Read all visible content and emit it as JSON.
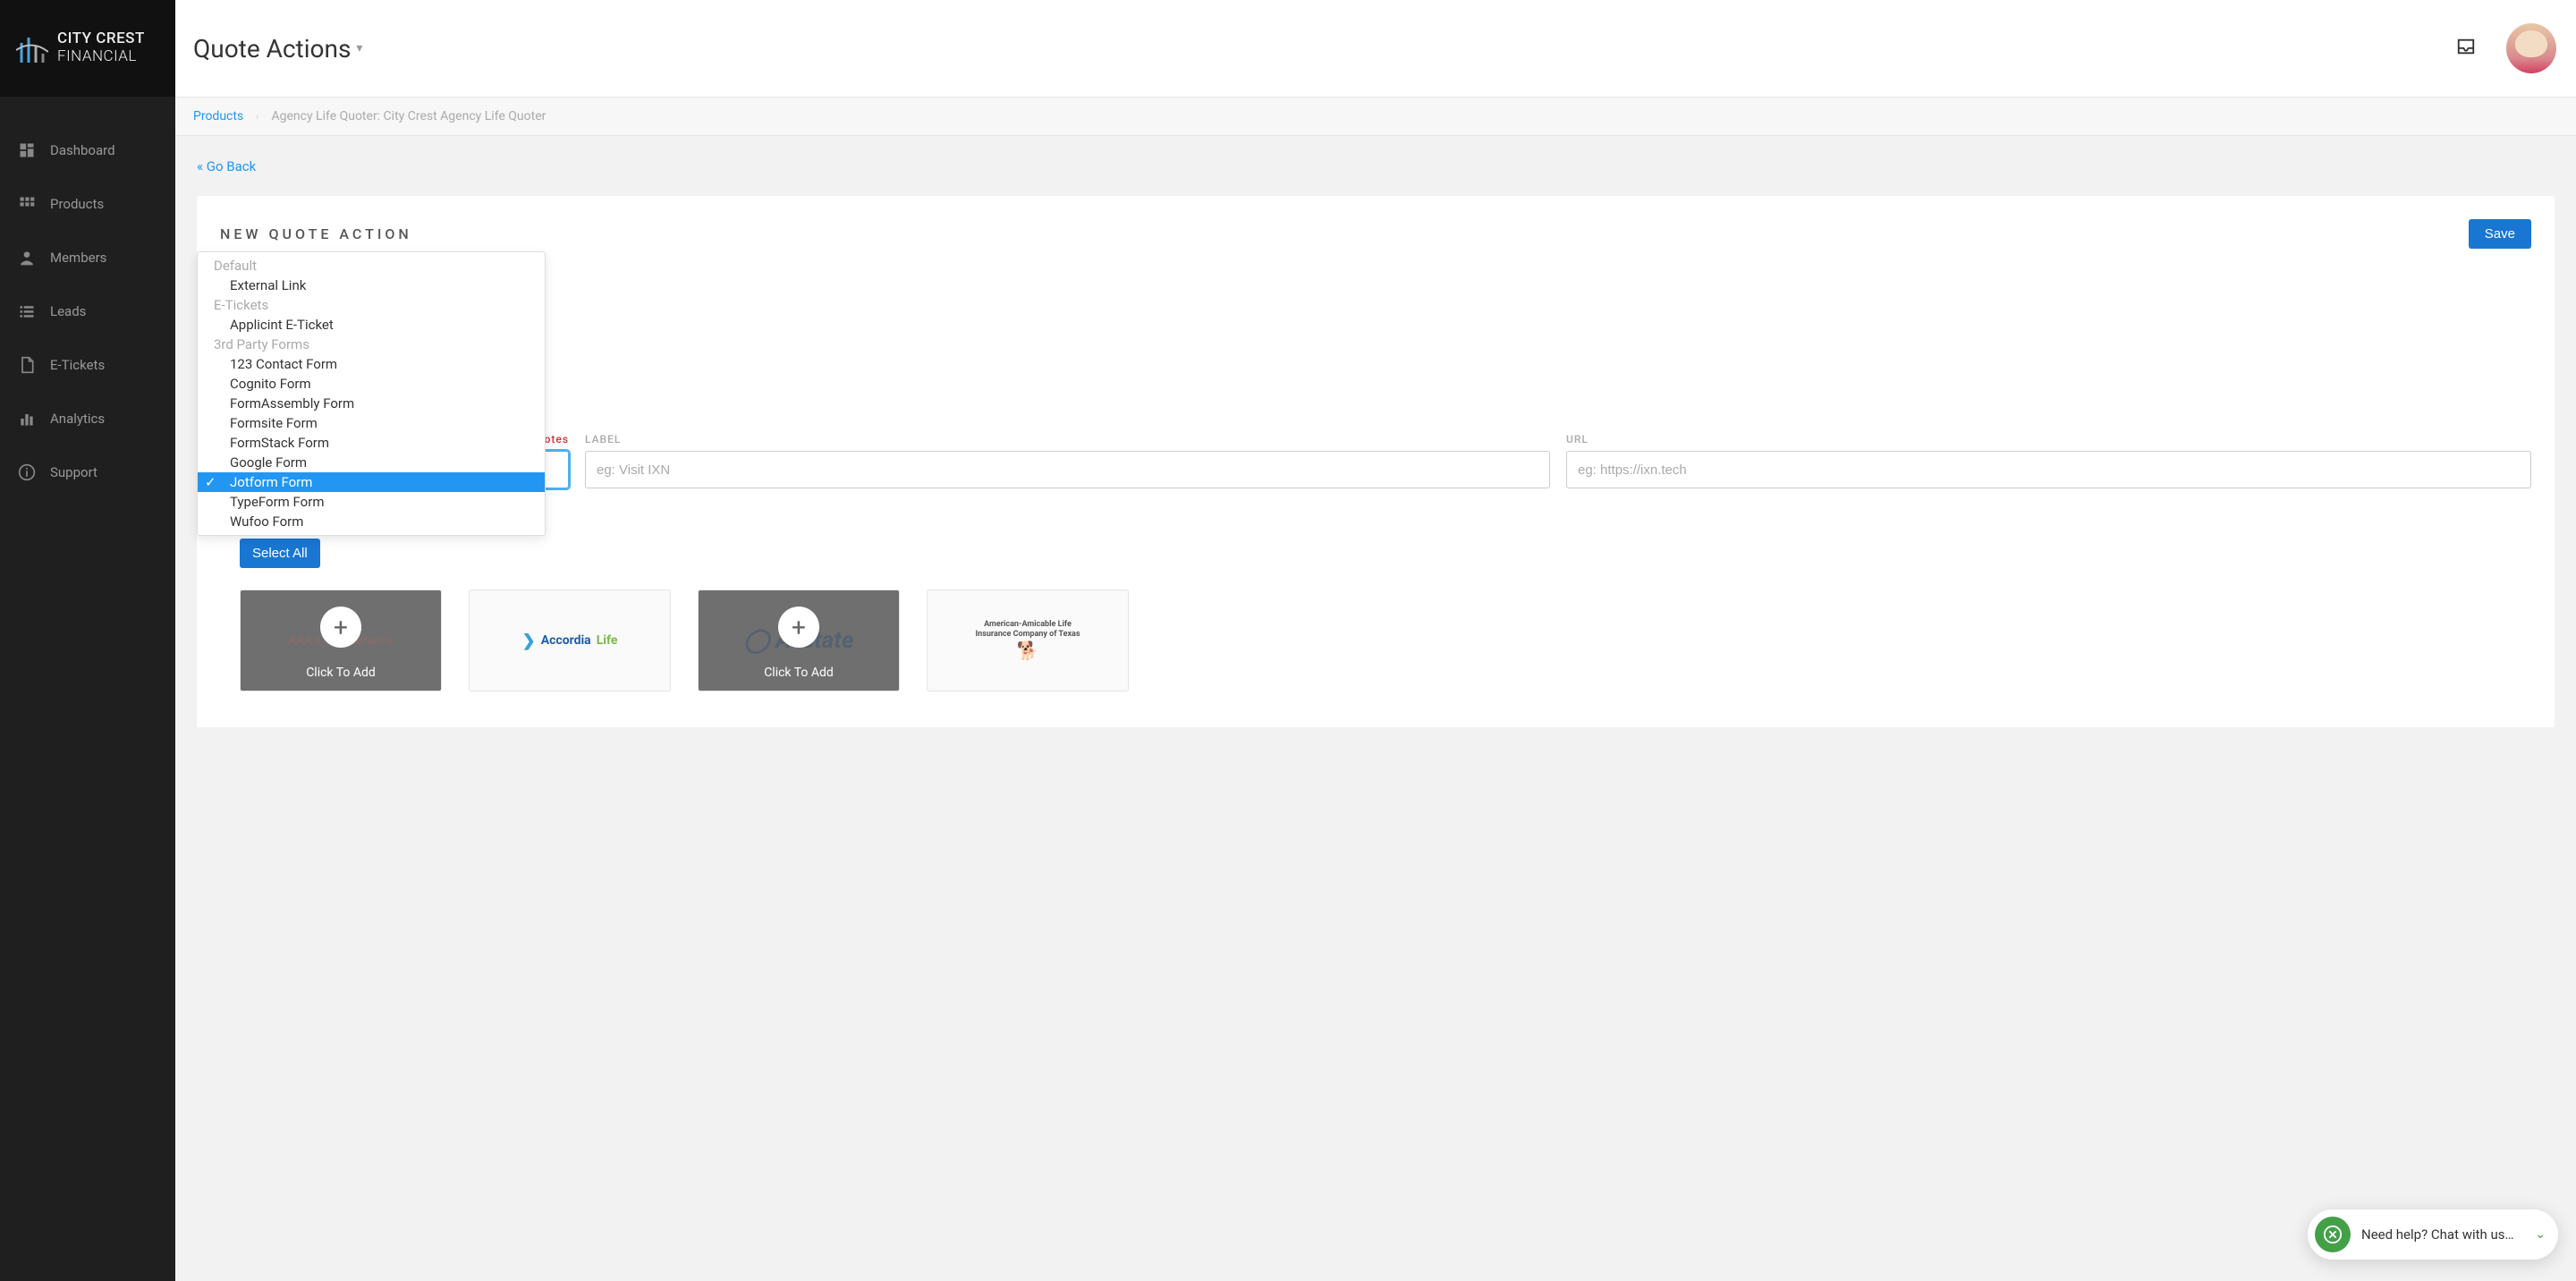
{
  "brand": {
    "line1": "CITY CREST",
    "line2": "FINANCIAL"
  },
  "sidebar": {
    "items": [
      {
        "label": "Dashboard"
      },
      {
        "label": "Products"
      },
      {
        "label": "Members"
      },
      {
        "label": "Leads"
      },
      {
        "label": "E-Tickets"
      },
      {
        "label": "Analytics"
      },
      {
        "label": "Support"
      }
    ]
  },
  "topbar": {
    "title": "Quote Actions"
  },
  "breadcrumb": {
    "link": "Products",
    "current": "Agency Life Quoter: City Crest Agency Life Quoter"
  },
  "go_back": "« Go Back",
  "card": {
    "title": "NEW QUOTE ACTION",
    "save": "Save"
  },
  "dropdown": {
    "groups": [
      {
        "label": "Default",
        "items": [
          "External Link"
        ]
      },
      {
        "label": "E-Tickets",
        "items": [
          "Applicint E-Ticket"
        ]
      },
      {
        "label": "3rd Party Forms",
        "items": [
          "123 Contact Form",
          "Cognito Form",
          "FormAssembly Form",
          "Formsite Form",
          "FormStack Form",
          "Google Form",
          "Jotform Form",
          "TypeForm Form",
          "Wufoo Form"
        ]
      }
    ],
    "selected": "Jotform Form"
  },
  "fields": {
    "hidden_label_text": "denotes",
    "label_label": "LABEL",
    "url_label": "URL",
    "label_placeholder": "eg: Visit IXN",
    "url_placeholder": "eg: https://ixn.tech"
  },
  "select_all": "Select All",
  "carriers": {
    "click_to_add": "Click To Add",
    "tiles": [
      {
        "name": "AAA Life Insurance",
        "ghost": true
      },
      {
        "name": "AccordiaLife",
        "ghost": false
      },
      {
        "name": "Allstate",
        "ghost": true
      },
      {
        "name": "American Amicable Life Insurance Company of Texas",
        "ghost": false
      }
    ]
  },
  "chat": {
    "text": "Need help? Chat with us…"
  }
}
